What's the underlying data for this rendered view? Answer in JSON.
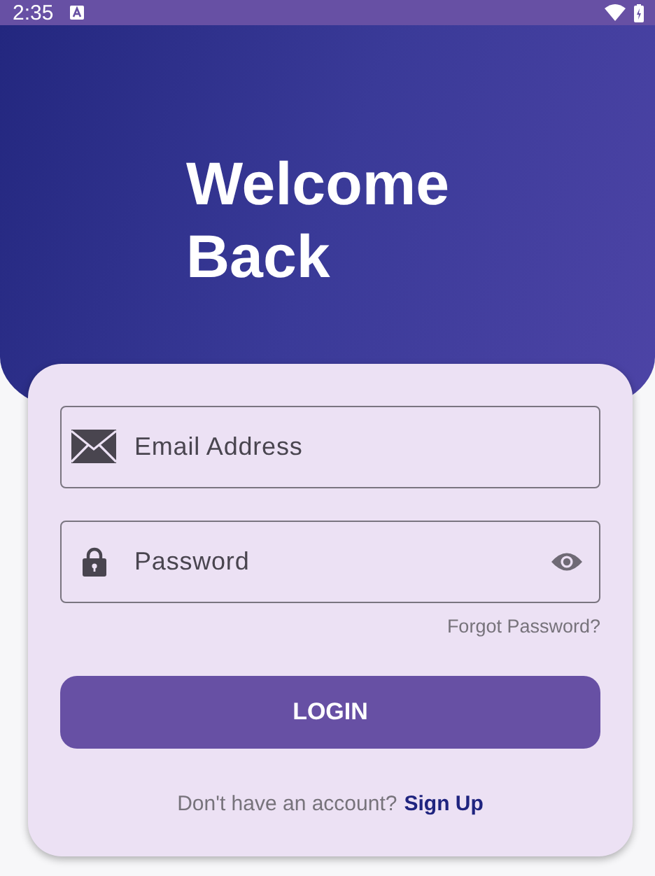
{
  "status_bar": {
    "time": "2:35"
  },
  "header": {
    "title": "Welcome Back"
  },
  "form": {
    "fields": [
      {
        "kind": "email",
        "placeholder": "Email Address"
      },
      {
        "kind": "password",
        "placeholder": "Password"
      }
    ],
    "forgot_link": "Forgot Password?",
    "login_button": "LOGIN",
    "signup_prompt": "Don't have an account?",
    "signup_link": "Sign Up"
  }
}
